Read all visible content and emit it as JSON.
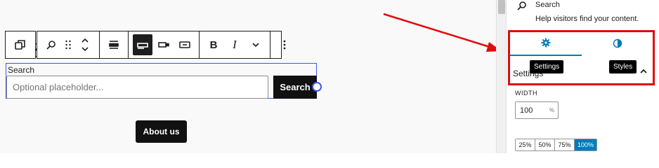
{
  "canvas": {
    "heading_left": "S",
    "heading_right": "nt",
    "search_block": {
      "label": "Search",
      "placeholder": "Optional placeholder...",
      "button_label": "Search"
    },
    "about_button": "About us"
  },
  "toolbar": {
    "bold_label": "B",
    "italic_label": "I"
  },
  "sidebar": {
    "block_title": "Search",
    "block_description": "Help visitors find your content.",
    "tabs": {
      "settings_tooltip": "Settings",
      "styles_tooltip": "Styles"
    },
    "settings_panel_title": "Settings",
    "width": {
      "label": "WIDTH",
      "value": "100",
      "unit": "%",
      "options": [
        "25%",
        "50%",
        "75%",
        "100%"
      ],
      "selected": "100%"
    }
  },
  "colors": {
    "accent": "#007cba",
    "selection": "#3858e9",
    "annotation_red": "#e10b0b"
  }
}
